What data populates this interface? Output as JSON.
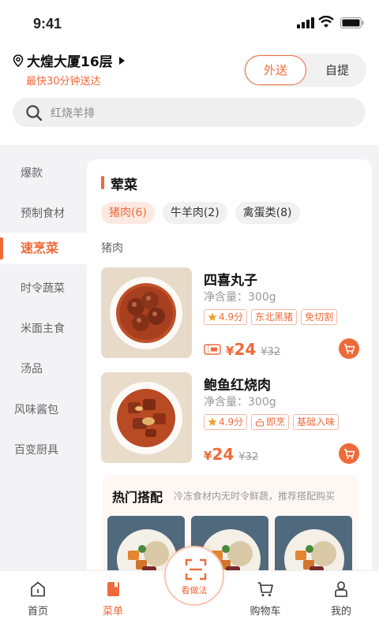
{
  "status_bar": {
    "time": "9:41"
  },
  "header": {
    "location": "大煌大厦16层",
    "delivery_tip": "最快30分钟送达",
    "mode_tabs": [
      {
        "label": "外送",
        "active": true
      },
      {
        "label": "自提",
        "active": false
      }
    ],
    "search_placeholder": "红烧羊排"
  },
  "sidebar": {
    "items": [
      {
        "label": "爆款"
      },
      {
        "label": "预制食材"
      },
      {
        "label": "速烹菜",
        "active": true
      },
      {
        "label": "时令蔬菜"
      },
      {
        "label": "米面主食"
      },
      {
        "label": "汤品"
      },
      {
        "label": "风味酱包"
      },
      {
        "label": "百变厨具"
      }
    ]
  },
  "content": {
    "section_title": "荤菜",
    "chips": [
      {
        "label": "猪肉(6)",
        "selected": true
      },
      {
        "label": "牛羊肉(2)"
      },
      {
        "label": "禽蛋类(8)"
      }
    ],
    "subsection": "猪肉",
    "products": [
      {
        "name": "四喜丸子",
        "net": "净含量：300g",
        "tags": [
          "4.9分",
          "东北黑猪",
          "免切割"
        ],
        "price_symbol": "¥",
        "price": "24",
        "original_price": "¥32",
        "has_coupon": true
      },
      {
        "name": "鲍鱼红烧肉",
        "net": "净含量：300g",
        "tags": [
          "4.9分",
          "即烹",
          "基础入味"
        ],
        "price_symbol": "¥",
        "price": "24",
        "original_price": "¥32",
        "has_coupon": false
      }
    ],
    "combo": {
      "title": "热门搭配",
      "desc": "冷冻食材内无时令鲜蔬，推荐搭配购买"
    }
  },
  "tabbar": {
    "items": [
      {
        "label": "首页",
        "icon": "home-icon"
      },
      {
        "label": "菜单",
        "icon": "menu-icon",
        "active": true
      },
      {
        "label": "购物车",
        "icon": "cart-icon"
      },
      {
        "label": "我的",
        "icon": "user-icon"
      }
    ],
    "scan_label": "看做法"
  },
  "colors": {
    "accent": "#ef6a3a",
    "sidebar_bg": "#f3f3f5"
  }
}
